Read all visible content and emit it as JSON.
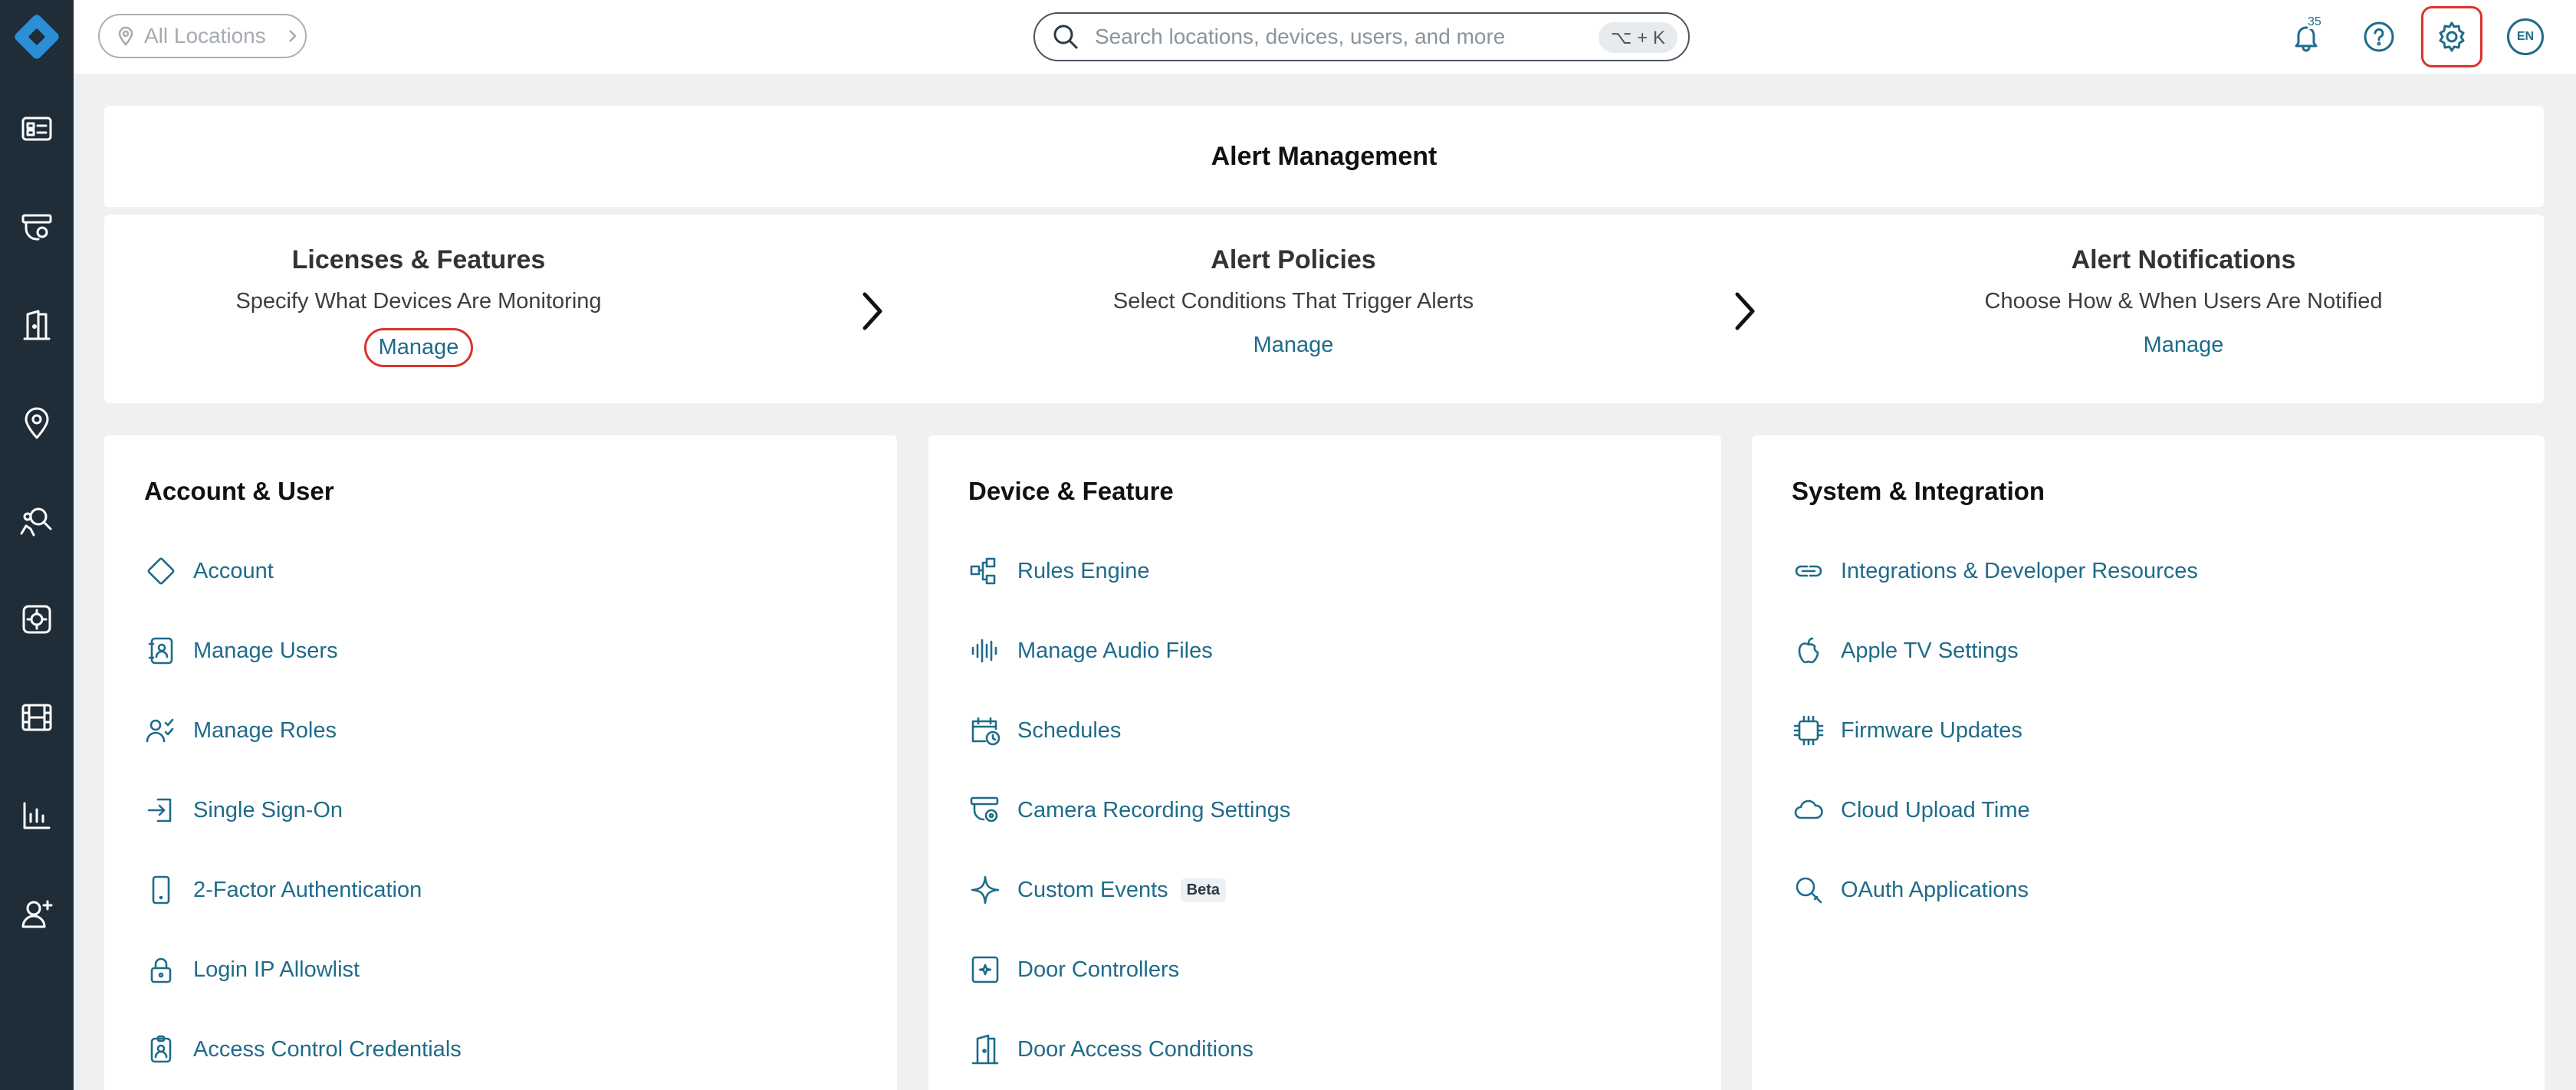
{
  "topbar": {
    "location_label": "All Locations",
    "search_placeholder": "Search locations, devices, users, and more",
    "search_shortcut": "⌥ + K",
    "notification_count": "35",
    "avatar_label": "EN"
  },
  "alert_management": {
    "title": "Alert Management",
    "steps": [
      {
        "title": "Licenses & Features",
        "subtitle": "Specify What Devices Are Monitoring",
        "link": "Manage"
      },
      {
        "title": "Alert Policies",
        "subtitle": "Select Conditions That Trigger Alerts",
        "link": "Manage"
      },
      {
        "title": "Alert Notifications",
        "subtitle": "Choose How & When Users Are Notified",
        "link": "Manage"
      }
    ]
  },
  "cards": [
    {
      "title": "Account & User",
      "items": [
        {
          "label": "Account",
          "icon": "diamond-icon"
        },
        {
          "label": "Manage Users",
          "icon": "user-book-icon"
        },
        {
          "label": "Manage Roles",
          "icon": "user-roles-icon"
        },
        {
          "label": "Single Sign-On",
          "icon": "sign-in-icon"
        },
        {
          "label": "2-Factor Authentication",
          "icon": "phone-icon"
        },
        {
          "label": "Login IP Allowlist",
          "icon": "lock-icon"
        },
        {
          "label": "Access Control Credentials",
          "icon": "badge-icon"
        }
      ]
    },
    {
      "title": "Device & Feature",
      "items": [
        {
          "label": "Rules Engine",
          "icon": "flow-icon"
        },
        {
          "label": "Manage Audio Files",
          "icon": "audio-wave-icon"
        },
        {
          "label": "Schedules",
          "icon": "calendar-clock-icon"
        },
        {
          "label": "Camera Recording Settings",
          "icon": "camera-settings-icon"
        },
        {
          "label": "Custom Events",
          "icon": "sparkle-icon",
          "badge": "Beta"
        },
        {
          "label": "Door Controllers",
          "icon": "door-controller-icon"
        },
        {
          "label": "Door Access Conditions",
          "icon": "door-icon"
        }
      ]
    },
    {
      "title": "System & Integration",
      "items": [
        {
          "label": "Integrations & Developer Resources",
          "icon": "link-icon"
        },
        {
          "label": "Apple TV Settings",
          "icon": "apple-icon"
        },
        {
          "label": "Firmware Updates",
          "icon": "chip-icon"
        },
        {
          "label": "Cloud Upload Time",
          "icon": "cloud-icon"
        },
        {
          "label": "OAuth Applications",
          "icon": "key-search-icon"
        }
      ]
    }
  ]
}
